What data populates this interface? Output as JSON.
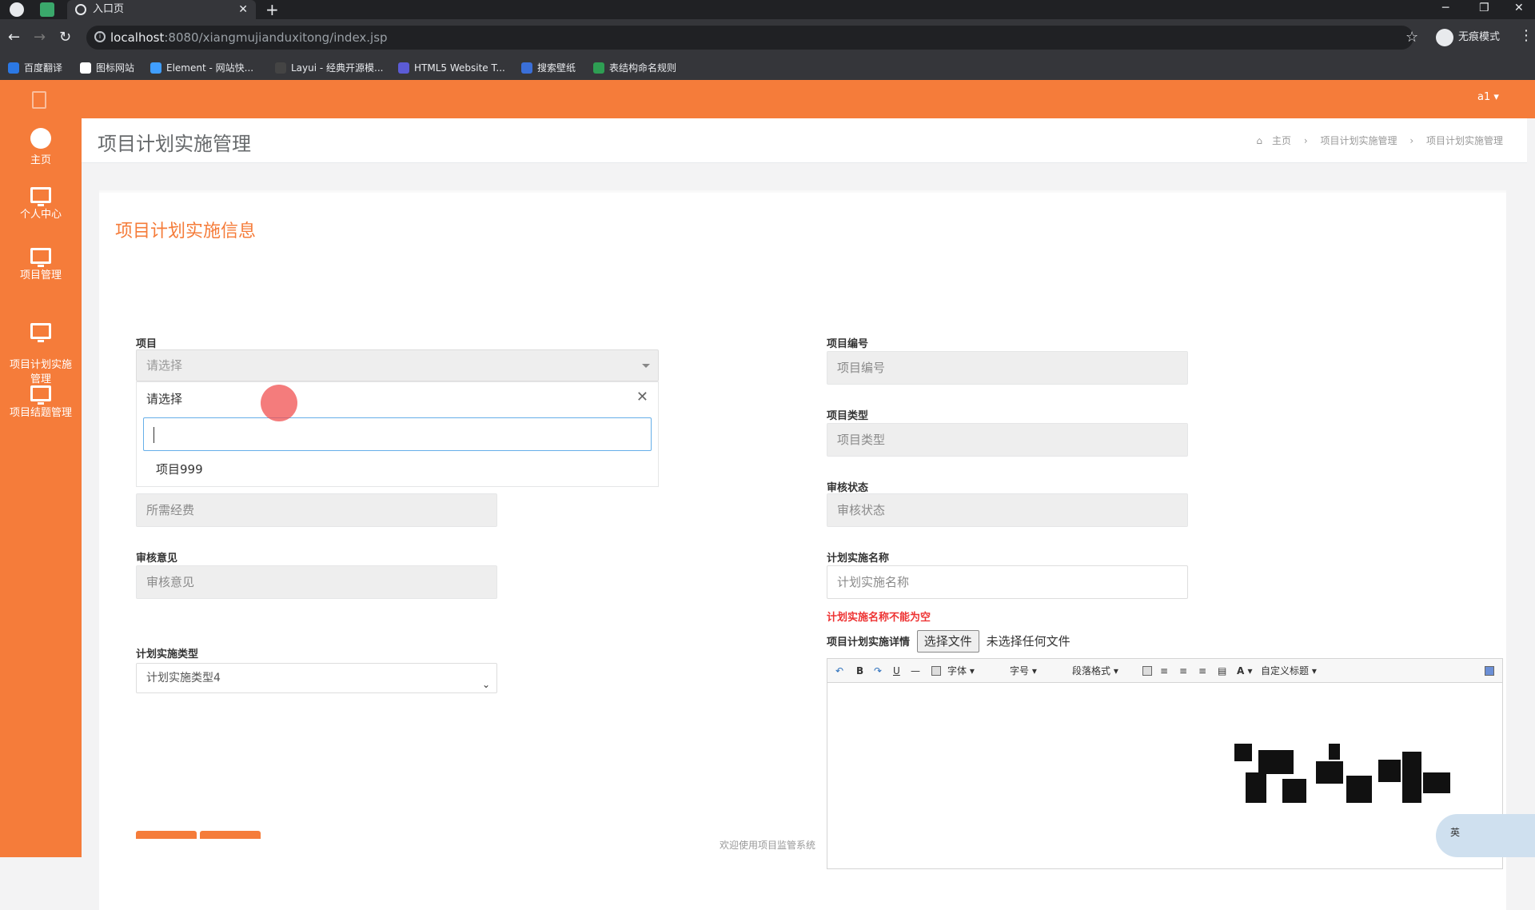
{
  "browser": {
    "tab_title": "入口页",
    "url_host": "localhost",
    "url_rest": ":8080/xiangmujianduxitong/index.jsp",
    "profile_label": "无痕模式",
    "bookmarks": [
      "百度翻译",
      "图标网站",
      "Element - 网站快...",
      "Layui - 经典开源模...",
      "HTML5 Website T...",
      "搜索壁纸",
      "表结构命名规则"
    ]
  },
  "app": {
    "user": "a1",
    "sidebar": [
      {
        "label": "主页",
        "icon": "dashboard-icon"
      },
      {
        "label": "个人中心",
        "icon": "monitor-icon"
      },
      {
        "label": "项目管理",
        "icon": "monitor-icon"
      },
      {
        "label": "项目计划实施\n管理",
        "icon": "monitor-icon"
      },
      {
        "label": "项目结题管理",
        "icon": "monitor-icon"
      }
    ],
    "page_title": "项目计划实施管理",
    "breadcrumb": [
      "主页",
      "项目计划实施管理",
      "项目计划实施管理"
    ],
    "form_title": "项目计划实施信息",
    "fields": {
      "project_label": "项目",
      "project_placeholder": "请选择",
      "dropdown_title": "请选择",
      "dropdown_option": "项目999",
      "funds_placeholder": "所需经费",
      "review_opinion_label": "审核意见",
      "review_opinion_placeholder": "审核意见",
      "plan_type_label": "计划实施类型",
      "plan_type_value": "计划实施类型4",
      "project_no_label": "项目编号",
      "project_no_placeholder": "项目编号",
      "project_type_label": "项目类型",
      "project_type_placeholder": "项目类型",
      "review_status_label": "审核状态",
      "review_status_placeholder": "审核状态",
      "plan_name_label": "计划实施名称",
      "plan_name_placeholder": "计划实施名称",
      "plan_name_error": "计划实施名称不能为空",
      "detail_label": "项目计划实施详情",
      "file_button": "选择文件",
      "file_status": "未选择任何文件"
    },
    "editor_toolbar": {
      "font": "字体",
      "size": "字号",
      "paragraph": "段落格式",
      "custom_title": "自定义标题"
    },
    "footer": "欢迎使用项目监管系统",
    "ime": "英",
    "colors": {
      "accent": "#f57c3a",
      "error": "#e33333"
    }
  }
}
